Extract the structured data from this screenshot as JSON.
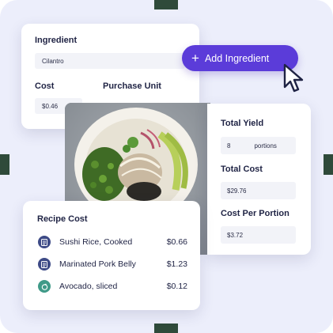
{
  "ingredient": {
    "ingredient_label": "Ingredient",
    "ingredient_value": "Cilantro",
    "cost_label": "Cost",
    "cost_value": "$0.46",
    "purchase_unit_label": "Purchase Unit"
  },
  "add_button": {
    "label": "Add Ingredient"
  },
  "summary": {
    "total_yield_label": "Total Yield",
    "total_yield_value": "8",
    "total_yield_unit": "portions",
    "total_cost_label": "Total Cost",
    "total_cost_value": "$29.76",
    "cost_per_portion_label": "Cost Per Portion",
    "cost_per_portion_value": "$3.72"
  },
  "recipe_cost": {
    "title": "Recipe Cost",
    "items": [
      {
        "name": "Sushi Rice, Cooked",
        "price": "$0.66",
        "icon": "recipe-icon"
      },
      {
        "name": "Marinated Pork Belly",
        "price": "$1.23",
        "icon": "recipe-icon"
      },
      {
        "name": "Avocado, sliced",
        "price": "$0.12",
        "icon": "ingredient-icon"
      }
    ]
  },
  "colors": {
    "accent": "#5b3cd9",
    "recipe_icon": "#3d4a86",
    "ingredient_icon": "#3f9a88"
  }
}
